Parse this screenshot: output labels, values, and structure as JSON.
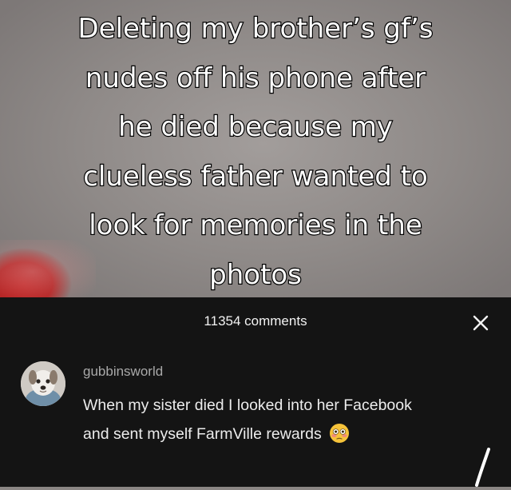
{
  "caption": {
    "lines": [
      "Deleting my brother’s gf’s",
      "nudes off his phone after",
      "he died because my",
      "clueless father wanted to",
      "look for memories in the",
      "photos"
    ]
  },
  "comments_sheet": {
    "count_label": "11354 comments",
    "close_icon": "close-icon",
    "comment": {
      "username": "gubbinsworld",
      "text": "When my sister died I looked into her Facebook and sent myself FarmVille rewards",
      "emoji": "flushed-face-icon"
    }
  }
}
